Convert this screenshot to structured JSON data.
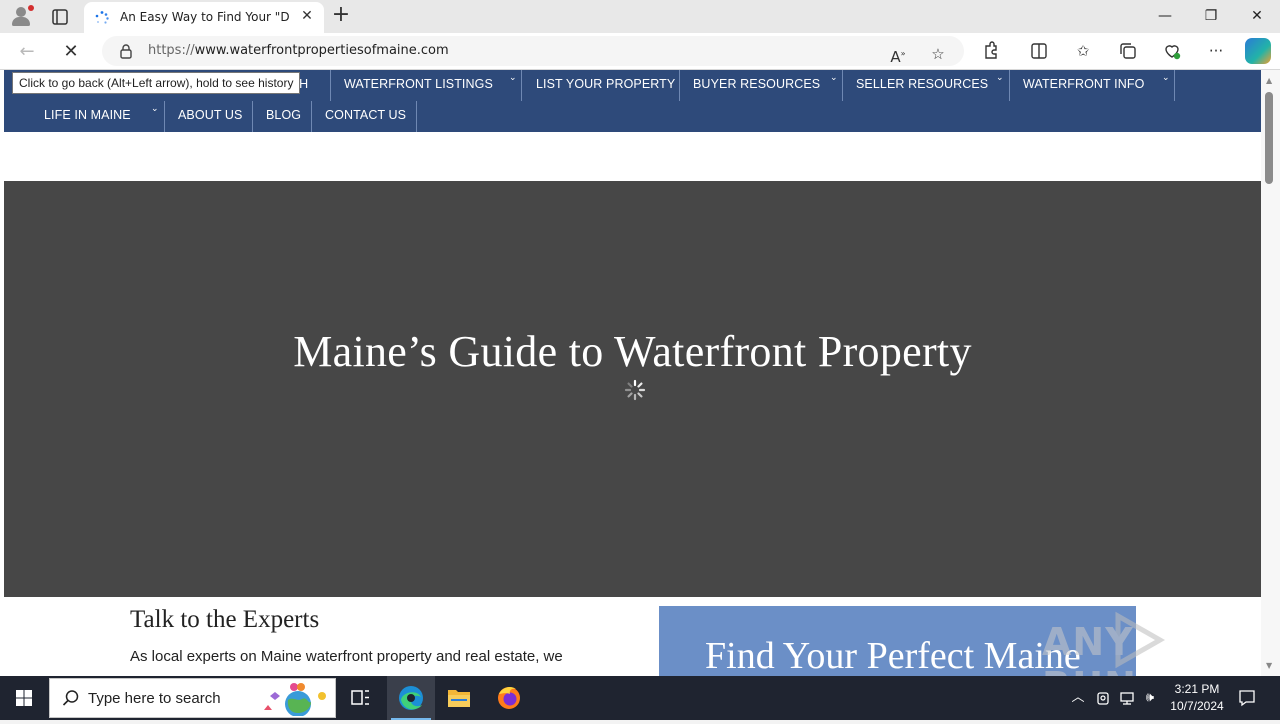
{
  "browser": {
    "tab_title": "An Easy Way to Find Your \"Dream",
    "new_tab_label": "+",
    "url_prefix": "https://",
    "url_domain": "www.waterfrontpropertiesofmaine.com",
    "tooltip": "Click to go back (Alt+Left arrow), hold to see history",
    "icons": [
      "profile-icon",
      "tab-actions-icon",
      "loading-favicon",
      "close-tab-icon",
      "back-icon",
      "stop-loading-icon",
      "lock-icon",
      "read-aloud-icon",
      "favorite-star-icon",
      "extensions-icon",
      "split-screen-icon",
      "favorites-icon",
      "collections-icon",
      "browser-essentials-icon",
      "more-icon",
      "copilot-icon"
    ]
  },
  "site_nav": {
    "row1": [
      {
        "label": "CH",
        "dropdown": false
      },
      {
        "label": "WATERFRONT LISTINGS",
        "dropdown": true
      },
      {
        "label": "LIST YOUR PROPERTY",
        "dropdown": false
      },
      {
        "label": "BUYER RESOURCES",
        "dropdown": true
      },
      {
        "label": "SELLER RESOURCES",
        "dropdown": true
      },
      {
        "label": "WATERFRONT INFO",
        "dropdown": true
      }
    ],
    "row2": [
      {
        "label": "LIFE IN MAINE",
        "dropdown": true
      },
      {
        "label": "ABOUT US",
        "dropdown": false
      },
      {
        "label": "BLOG",
        "dropdown": false
      },
      {
        "label": "CONTACT US",
        "dropdown": false
      }
    ]
  },
  "hero": {
    "heading": "Maine’s Guide to Waterfront Property"
  },
  "experts": {
    "title": "Talk to the Experts",
    "text": "As local experts on Maine waterfront property and real estate, we"
  },
  "find_box": {
    "heading": "Find Your Perfect Maine"
  },
  "watermark": "ANY RUN",
  "taskbar": {
    "search_placeholder": "Type here to search",
    "apps": [
      "task-view-icon",
      "edge-icon",
      "file-explorer-icon",
      "firefox-icon"
    ],
    "time": "3:21 PM",
    "date": "10/7/2024"
  },
  "colors": {
    "nav_bg": "#2e4a7a",
    "hero_bg": "#474747",
    "find_box_bg": "#6b8fc7",
    "taskbar_bg": "#1f2430"
  }
}
